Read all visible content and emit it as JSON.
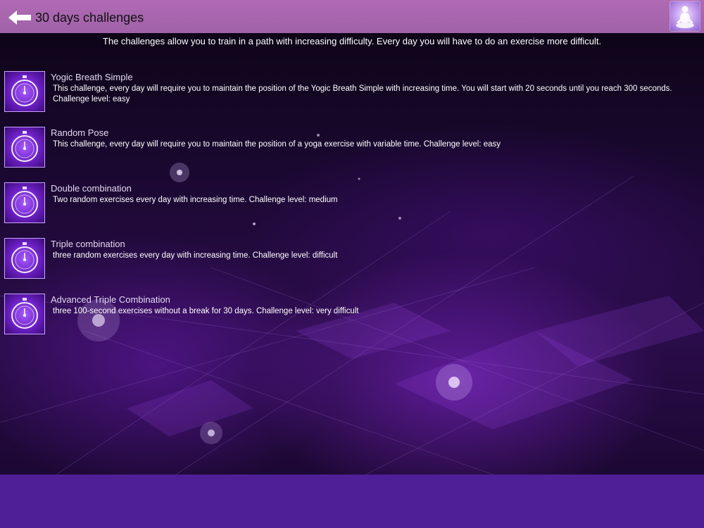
{
  "header": {
    "title": "30 days challenges"
  },
  "intro": "The challenges allow you to train in a path with increasing difficulty. Every day you will have to do an exercise more difficult.",
  "challenges": [
    {
      "title": "Yogic Breath Simple",
      "description": "This challenge, every day will require you to maintain the position of the Yogic Breath Simple with increasing time. You will start with 20 seconds until you reach 300 seconds. Challenge level: easy"
    },
    {
      "title": "Random Pose",
      "description": "This challenge, every day will require you to maintain the position of a yoga exercise with variable time. Challenge level: easy"
    },
    {
      "title": "Double combination",
      "description": "Two random exercises every day with increasing time. Challenge level: medium"
    },
    {
      "title": "Triple combination",
      "description": "three random exercises every day with increasing time. Challenge level: difficult"
    },
    {
      "title": "Advanced Triple Combination",
      "description": "three 100-second exercises without a break for 30 days. Challenge level: very difficult"
    }
  ],
  "colors": {
    "header": "#a966ae",
    "footer": "#4e1f96",
    "icon_border": "#caa2ff"
  },
  "icons": {
    "back": "back-arrow-icon",
    "avatar": "meditation-avatar-icon",
    "challenge": "stopwatch-icon"
  }
}
